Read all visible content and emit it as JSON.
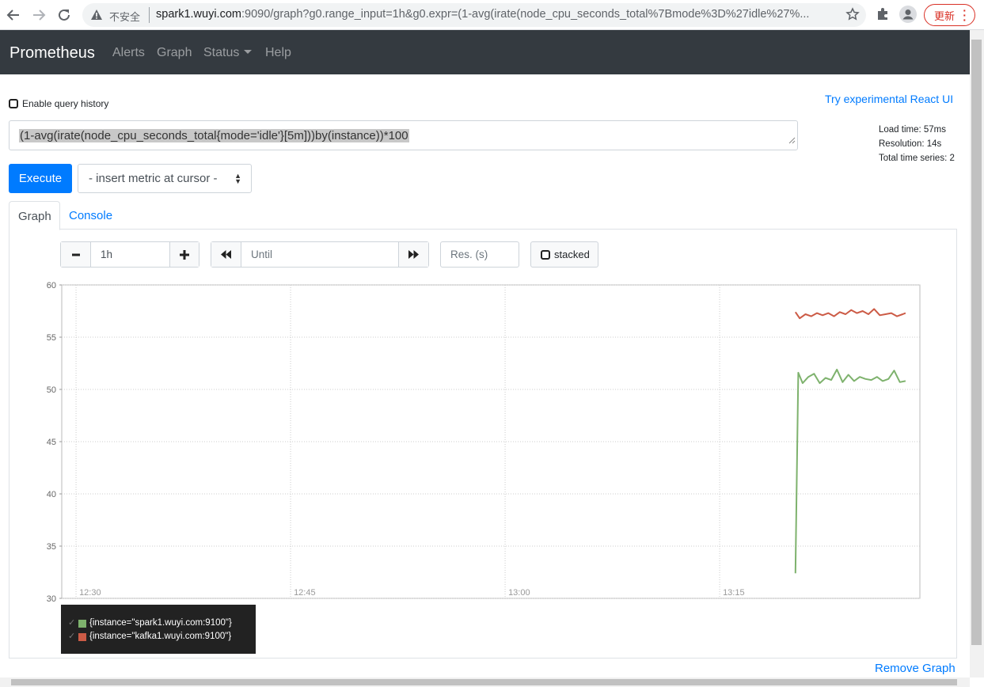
{
  "browser": {
    "insecure_label": "不安全",
    "url_host": "spark1.wuyi.com",
    "url_rest": ":9090/graph?g0.range_input=1h&g0.expr=(1-avg(irate(node_cpu_seconds_total%7Bmode%3D%27idle%27%...",
    "update_label": "更新"
  },
  "navbar": {
    "brand": "Prometheus",
    "links": [
      "Alerts",
      "Graph",
      "Status",
      "Help"
    ]
  },
  "page": {
    "history_label": "Enable query history",
    "react_link": "Try experimental React UI",
    "expression": "(1-avg(irate(node_cpu_seconds_total{mode='idle'}[5m]))by(instance))*100",
    "stats": {
      "load_time": "Load time: 57ms",
      "resolution": "Resolution: 14s",
      "total_series": "Total time series: 2"
    },
    "execute_label": "Execute",
    "metric_select": "- insert metric at cursor -",
    "tabs": {
      "graph": "Graph",
      "console": "Console"
    },
    "controls": {
      "minus": "−",
      "range": "1h",
      "plus": "+",
      "until_placeholder": "Until",
      "res_placeholder": "Res. (s)",
      "stacked": "stacked"
    },
    "remove_graph": "Remove Graph"
  },
  "chart_data": {
    "type": "line",
    "ylim": [
      30,
      60
    ],
    "yticks": [
      30,
      35,
      40,
      45,
      50,
      55,
      60
    ],
    "xticks": [
      "12:30",
      "12:45",
      "13:00",
      "13:15"
    ],
    "xlim_minutes": [
      -1,
      59
    ],
    "xtick_minutes": [
      0,
      15,
      30,
      45
    ],
    "grid": true,
    "legend_position": "bottom-left",
    "series": [
      {
        "name": "{instance=\"spark1.wuyi.com:9100\"}",
        "color": "#7eb26d",
        "x": [
          50.3,
          50.5,
          50.8,
          51.2,
          51.6,
          52.0,
          52.4,
          52.8,
          53.2,
          53.6,
          54.0,
          54.4,
          54.8,
          55.2,
          55.6,
          56.0,
          56.4,
          56.8,
          57.2,
          57.6,
          58.0
        ],
        "values": [
          32.4,
          51.6,
          50.6,
          51.2,
          51.5,
          50.6,
          51.1,
          50.9,
          51.9,
          50.7,
          51.4,
          50.8,
          51.2,
          51.0,
          50.9,
          51.2,
          50.8,
          51.0,
          51.8,
          50.7,
          50.8
        ]
      },
      {
        "name": "{instance=\"kafka1.wuyi.com:9100\"}",
        "color": "#cc5b46",
        "x": [
          50.3,
          50.6,
          51.0,
          51.4,
          51.8,
          52.2,
          52.6,
          53.0,
          53.4,
          53.8,
          54.2,
          54.6,
          55.0,
          55.4,
          55.8,
          56.2,
          56.6,
          57.0,
          57.4,
          57.8,
          58.0
        ],
        "values": [
          57.4,
          56.8,
          57.2,
          57.0,
          57.3,
          57.1,
          57.3,
          57.0,
          57.4,
          57.2,
          57.6,
          57.3,
          57.5,
          57.2,
          57.7,
          57.1,
          57.2,
          57.3,
          57.0,
          57.2,
          57.3
        ]
      }
    ]
  }
}
